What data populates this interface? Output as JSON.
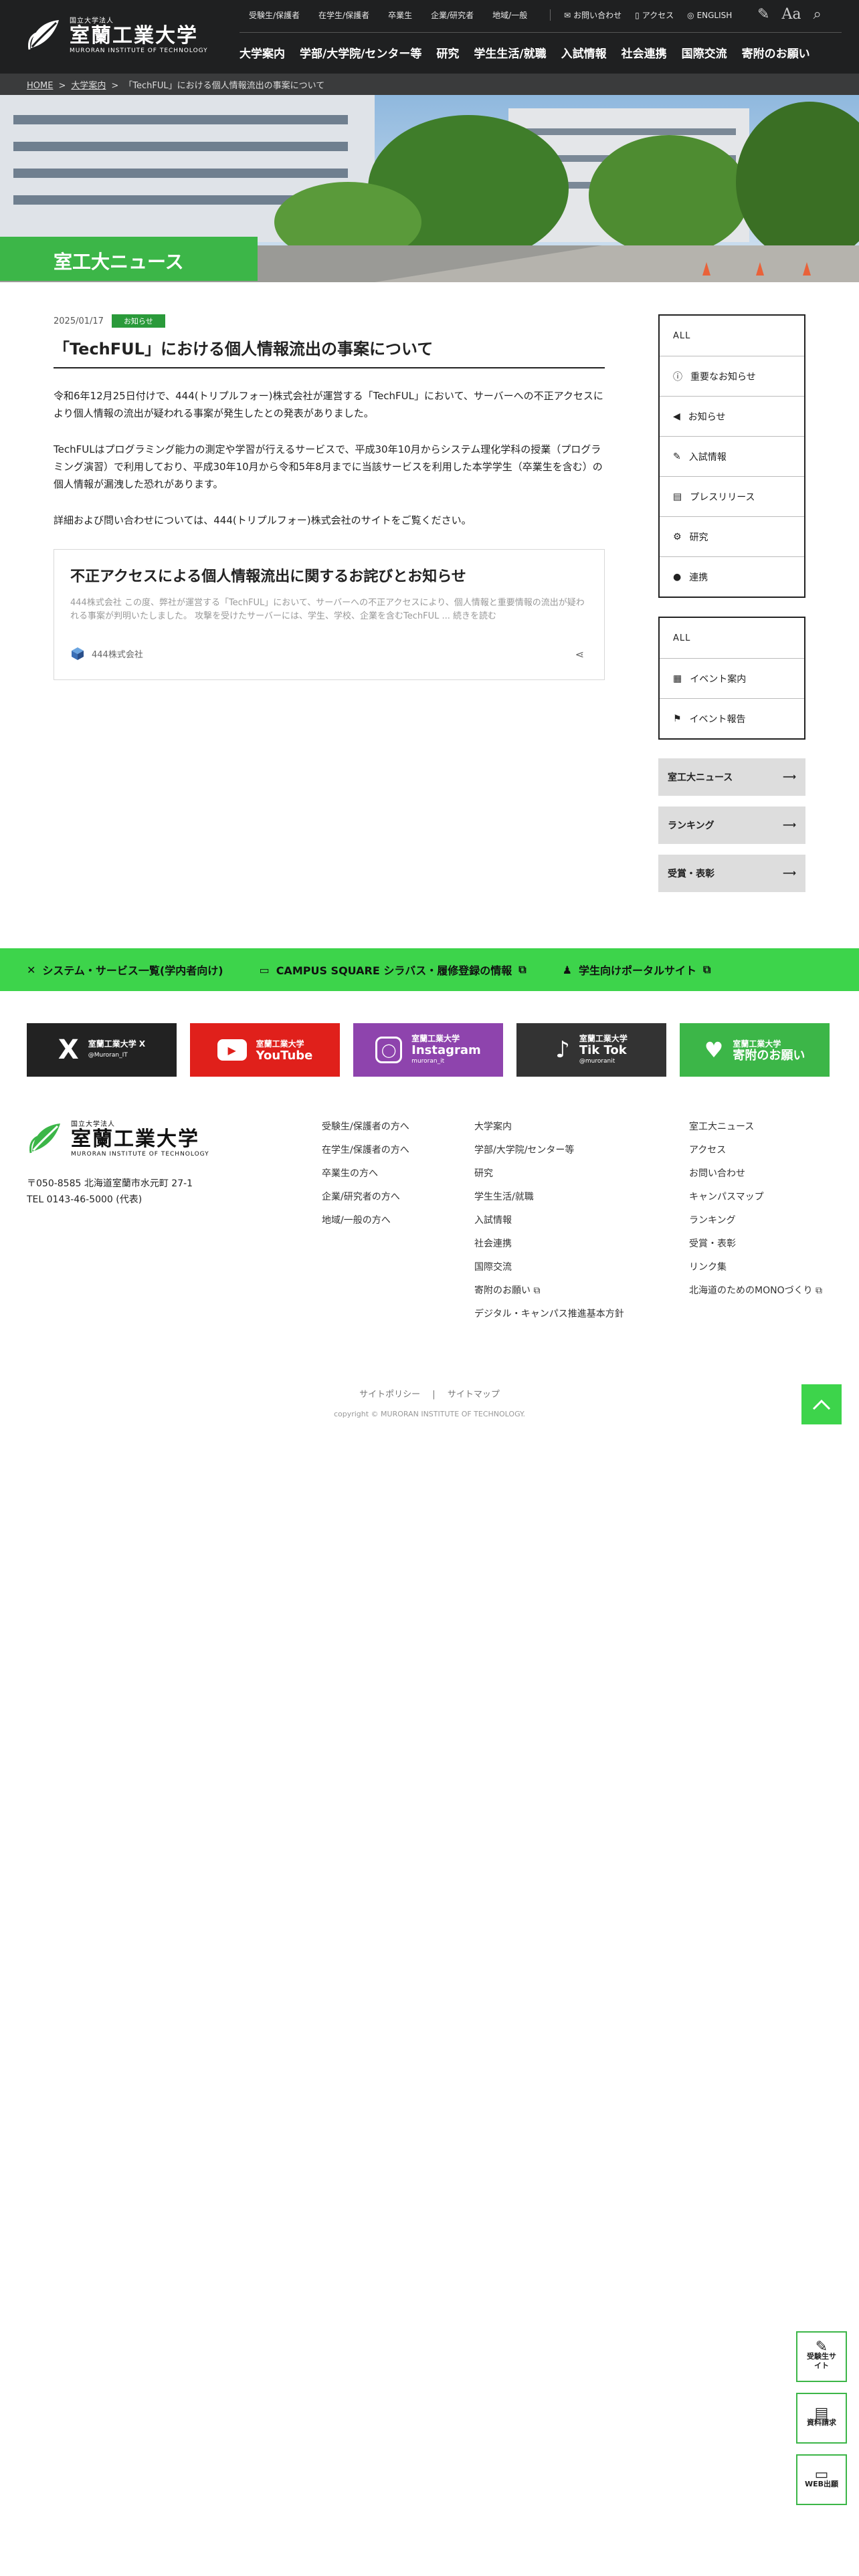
{
  "header": {
    "logo_small": "国立大学法人",
    "logo_big": "室蘭工業大学",
    "logo_en": "MURORAN INSTITUTE OF TECHNOLOGY",
    "top_links": [
      "受験生/保護者",
      "在学生/保護者",
      "卒業生",
      "企業/研究者",
      "地域/一般"
    ],
    "util_links": [
      "お問い合わせ",
      "アクセス",
      "ENGLISH"
    ],
    "main_nav": [
      "大学案内",
      "学部/大学院/センター等",
      "研究",
      "学生生活/就職",
      "入試情報",
      "社会連携",
      "国際交流",
      "寄附のお願い"
    ]
  },
  "breadcrumb": {
    "home": "HOME",
    "section": "大学案内",
    "current": "「TechFUL」における個人情報流出の事案について"
  },
  "hero": {
    "title": "室工大ニュース"
  },
  "article": {
    "date": "2025/01/17",
    "badge": "お知らせ",
    "title": "「TechFUL」における個人情報流出の事案について",
    "p1": "令和6年12月25日付けで、444(トリプルフォー)株式会社が運営する「TechFUL」において、サーバーへの不正アクセスにより個人情報の流出が疑われる事案が発生したとの発表がありました。",
    "p2": "TechFULはプログラミング能力の測定や学習が行えるサービスで、平成30年10月からシステム理化学科の授業（プログラミング演習）で利用しており、平成30年10月から令和5年8月までに当該サービスを利用した本学学生（卒業生を含む）の個人情報が漏洩した恐れがあります。",
    "p3": "詳細および問い合わせについては、444(トリプルフォー)株式会社のサイトをご覧ください。",
    "card_title": "不正アクセスによる個人情報流出に関するお詫びとお知らせ",
    "card_desc": "444株式会社 この度、弊社が運営する「TechFUL」において、サーバーへの不正アクセスにより、個人情報と重要情報の流出が疑われる事案が判明いたしました。 攻撃を受けたサーバーには、学生、学校、企業を含むTechFUL ... 続きを読む",
    "card_source": "444株式会社"
  },
  "sidebar": {
    "categories": [
      "ALL",
      "重要なお知らせ",
      "お知らせ",
      "入試情報",
      "プレスリリース",
      "研究",
      "連携"
    ],
    "events": [
      "ALL",
      "イベント案内",
      "イベント報告"
    ],
    "links": [
      "室工大ニュース",
      "ランキング",
      "受賞・表彰"
    ]
  },
  "greenbar": [
    "システム・サービス一覧(学内者向け)",
    "CAMPUS SQUARE シラバス・履修登録の情報",
    "学生向けポータルサイト"
  ],
  "social": [
    {
      "a": "室蘭工業大学 X",
      "c": "@Muroran_IT",
      "color": "#222222"
    },
    {
      "a": "室蘭工業大学",
      "b": "YouTube",
      "color": "#e0201b"
    },
    {
      "a": "室蘭工業大学",
      "b": "Instagram",
      "c": "muroran_it",
      "color": "#8e44ad"
    },
    {
      "a": "室蘭工業大学",
      "b": "Tik Tok",
      "c": "@muroranit",
      "color": "#333333"
    },
    {
      "a": "室蘭工業大学",
      "b": "寄附のお願い",
      "color": "#3cb648"
    }
  ],
  "footer": {
    "address": "〒050-8585 北海道室蘭市水元町 27-1",
    "tel": "TEL 0143-46-5000 (代表)",
    "col1": [
      "受験生/保護者の方へ",
      "在学生/保護者の方へ",
      "卒業生の方へ",
      "企業/研究者の方へ",
      "地域/一般の方へ"
    ],
    "col2": [
      "大学案内",
      "学部/大学院/センター等",
      "研究",
      "学生生活/就職",
      "入試情報",
      "社会連携",
      "国際交流",
      "寄附のお願い",
      "デジタル・キャンパス推進基本方針"
    ],
    "col3": [
      "室工大ニュース",
      "アクセス",
      "お問い合わせ",
      "キャンパスマップ",
      "ランキング",
      "受賞・表彰",
      "リンク集",
      "北海道のためのMONOづくり"
    ],
    "policy": "サイトポリシー",
    "sitemap": "サイトマップ",
    "copyright": "copyright © MURORAN INSTITUTE OF TECHNOLOGY."
  },
  "floating": [
    "受験生サイト",
    "資料請求",
    "WEB出願"
  ]
}
